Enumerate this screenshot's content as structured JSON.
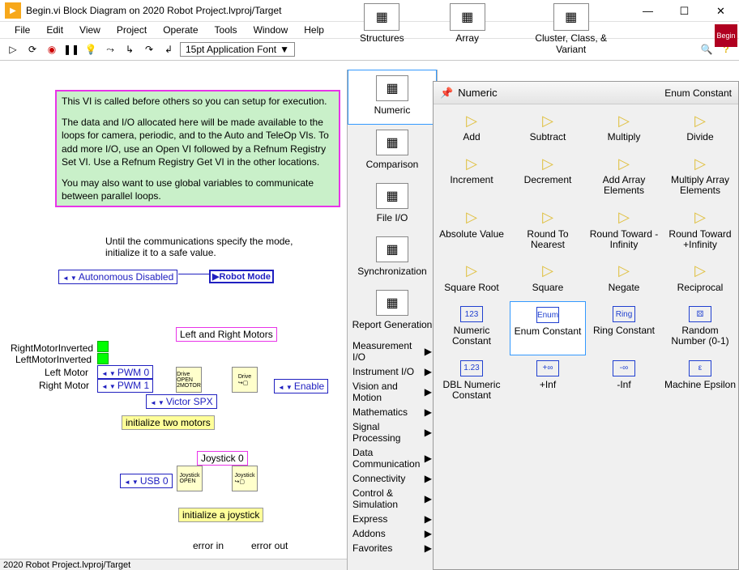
{
  "title": "Begin.vi Block Diagram on 2020 Robot Project.lvproj/Target",
  "menubar": [
    "File",
    "Edit",
    "View",
    "Project",
    "Operate",
    "Tools",
    "Window",
    "Help"
  ],
  "begin_badge": "Begin",
  "toolbar": {
    "font": "15pt Application Font"
  },
  "comment": {
    "p1": "This VI is called before others so you can setup for execution.",
    "p2": "The data and I/O allocated here will be made available to the loops for camera, periodic, and to the Auto and TeleOp VIs. To add more I/O, use an Open VI followed by a Refnum Registry Set VI.  Use a Refnum Registry Get VI in the other locations.",
    "p3": "You may also want to use global variables to communicate between parallel loops."
  },
  "diagram": {
    "safe_note": "Until the communications specify the mode, initialize it to a safe value.",
    "auto_disabled": "Autonomous Disabled",
    "robot_mode": "Robot Mode",
    "lr_motors": "Left and Right Motors",
    "right_inv": "RightMotorInverted",
    "left_inv": "LeftMotorInverted",
    "left_motor": "Left Motor",
    "right_motor": "Right Motor",
    "pwm0": "PWM 0",
    "pwm1": "PWM 1",
    "victor": "Victor SPX",
    "enable": "Enable",
    "init_two": "initialize two motors",
    "joystick0": "Joystick 0",
    "usb0": "USB 0",
    "init_joy": "initialize a joystick",
    "error_in": "error in",
    "error_out": "error out"
  },
  "status": "2020 Robot Project.lvproj/Target",
  "top_cats": [
    {
      "label": "Structures"
    },
    {
      "label": "Array"
    },
    {
      "label": "Cluster, Class, & Variant"
    }
  ],
  "strip": [
    {
      "label": "Numeric",
      "selected": true
    },
    {
      "label": "Comparison"
    },
    {
      "label": "File I/O"
    },
    {
      "label": "Synchronization"
    },
    {
      "label": "Report Generation"
    }
  ],
  "strip_text": [
    "Measurement I/O",
    "Instrument I/O",
    "Vision and Motion",
    "Mathematics",
    "Signal Processing",
    "Data Communication",
    "Connectivity",
    "Control & Simulation",
    "Express",
    "Addons",
    "Favorites"
  ],
  "submenu_title": "Numeric",
  "submenu_caption": "Enum Constant",
  "sub_items": [
    {
      "l": "Add",
      "i": "▷",
      "t": "tri"
    },
    {
      "l": "Subtract",
      "i": "▷",
      "t": "tri"
    },
    {
      "l": "Multiply",
      "i": "▷",
      "t": "tri"
    },
    {
      "l": "Divide",
      "i": "▷",
      "t": "tri"
    },
    {
      "l": "Increment",
      "i": "▷",
      "t": "tri"
    },
    {
      "l": "Decrement",
      "i": "▷",
      "t": "tri"
    },
    {
      "l": "Add Array Elements",
      "i": "▷",
      "t": "tri"
    },
    {
      "l": "Multiply Array Elements",
      "i": "▷",
      "t": "tri"
    },
    {
      "l": "Absolute Value",
      "i": "▷",
      "t": "tri"
    },
    {
      "l": "Round To Nearest",
      "i": "▷",
      "t": "tri"
    },
    {
      "l": "Round Toward -Infinity",
      "i": "▷",
      "t": "tri"
    },
    {
      "l": "Round Toward +Infinity",
      "i": "▷",
      "t": "tri"
    },
    {
      "l": "Square Root",
      "i": "▷",
      "t": "tri"
    },
    {
      "l": "Square",
      "i": "▷",
      "t": "tri"
    },
    {
      "l": "Negate",
      "i": "▷",
      "t": "tri"
    },
    {
      "l": "Reciprocal",
      "i": "▷",
      "t": "tri"
    },
    {
      "l": "Numeric Constant",
      "i": "123",
      "t": "box"
    },
    {
      "l": "Enum Constant",
      "i": "Enum",
      "t": "box",
      "sel": true
    },
    {
      "l": "Ring Constant",
      "i": "Ring",
      "t": "box"
    },
    {
      "l": "Random Number (0-1)",
      "i": "⚄",
      "t": "box"
    },
    {
      "l": "DBL Numeric Constant",
      "i": "1.23",
      "t": "box"
    },
    {
      "l": "+Inf",
      "i": "+∞",
      "t": "box"
    },
    {
      "l": "-Inf",
      "i": "-∞",
      "t": "box"
    },
    {
      "l": "Machine Epsilon",
      "i": "ε",
      "t": "box"
    }
  ]
}
